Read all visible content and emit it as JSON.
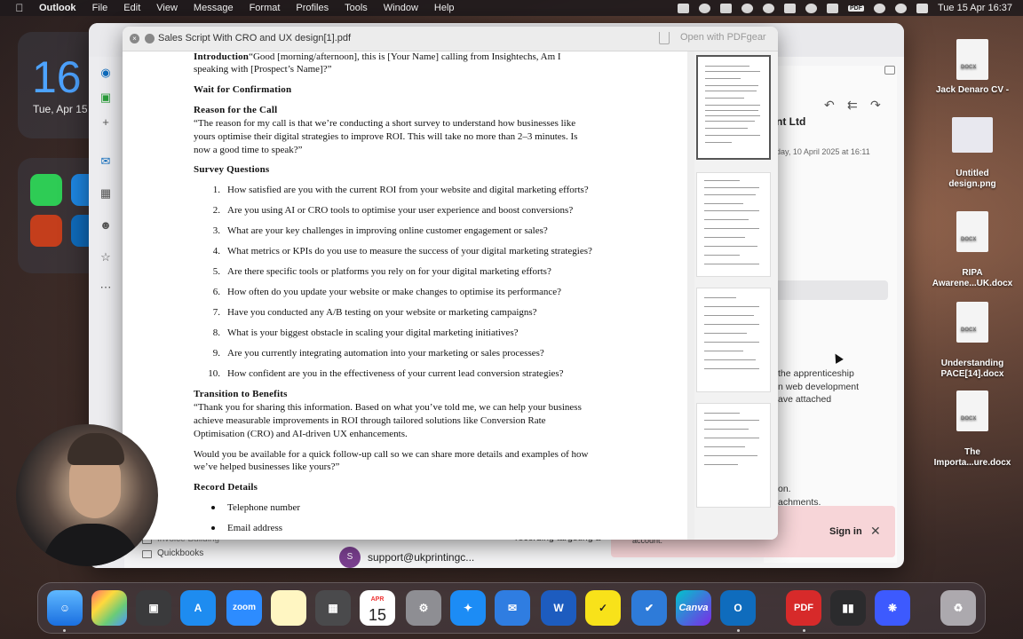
{
  "menubar": {
    "app_name": "Outlook",
    "menus": [
      "File",
      "Edit",
      "View",
      "Message",
      "Format",
      "Profiles",
      "Tools",
      "Window",
      "Help"
    ],
    "datetime": "Tue 15 Apr  16:37",
    "pdf_badge": "PDF"
  },
  "widget": {
    "day": "16",
    "date": "Tue, Apr 15"
  },
  "outlook": {
    "company_fragment": "nt Ltd",
    "date_fragment": "day, 10 April 2025 at 16:11",
    "body_fragment": "the apprenticeship\nn web development\nave attached",
    "body_fragment2": "on.\nachments.",
    "folder": "Quickbooks",
    "folder_prev": "Invoice Building",
    "mail_avatar": "S",
    "mail_from": "support@ukprintingc...",
    "preview_fragment": "recording targeting a",
    "signin_msg": "nething\nfor this\naccount.",
    "signin_button": "Sign in"
  },
  "pdf": {
    "title": "Sales Script With CRO and UX design[1].pdf",
    "open_button": "Open with PDFgear",
    "intro_head": "Introduction",
    "intro_line1": "“Good [morning/afternoon], this is [Your Name] calling from Insightechs, Am I",
    "intro_line2": "speaking with [Prospect’s Name]?”",
    "wait_head": "Wait for Confirmation",
    "reason_head": "Reason for the Call",
    "reason_lines": [
      "“The reason for my call is that we’re conducting a short survey to understand how businesses like",
      "yours optimise their digital strategies to improve ROI. This will take no more than 2–3 minutes. Is",
      "now a good time to speak?”"
    ],
    "survey_head": "Survey Questions",
    "questions": [
      "How satisfied are you with the current ROI from your website and digital marketing efforts?",
      "Are you using AI or CRO tools to optimise your user experience and boost conversions?",
      "What are your key challenges in improving online customer engagement or sales?",
      "What metrics or KPIs do you use to measure the success of your digital marketing strategies?",
      "Are there specific tools or platforms you rely on for your digital marketing efforts?",
      "How often do you update your website or make changes to optimise its performance?",
      "Have you conducted any A/B testing on your website or marketing campaigns?",
      "What is your biggest obstacle in scaling your digital marketing initiatives?",
      "Are you currently integrating automation into your marketing or sales processes?",
      "How confident are you in the effectiveness of your current lead conversion strategies?"
    ],
    "question_numbers": [
      "1.",
      "2.",
      "3.",
      "4.",
      "5.",
      "6.",
      "7.",
      "8.",
      "9.",
      "10."
    ],
    "transition_head": "Transition to Benefits",
    "transition_lines": [
      "“Thank you for sharing this information. Based on what you’ve told me, we can help your business",
      "achieve measurable improvements in ROI through tailored solutions like Conversion Rate",
      "Optimisation (CRO) and AI-driven UX enhancements."
    ],
    "followup_lines": [
      "Would you be available for a quick follow-up call so we can share more details and examples of how",
      "we’ve helped businesses like yours?”"
    ],
    "record_head": "Record Details",
    "record_items": [
      "Telephone number",
      "Email address"
    ]
  },
  "desktop_files": [
    {
      "name": "Jack Denaro CV -",
      "tag": "DOCX"
    },
    {
      "name": "Untitled\ndesign.png",
      "tag": ""
    },
    {
      "name": "RIPA\nAwarene...UK.docx",
      "tag": "DOCX"
    },
    {
      "name": "Understanding\nPACE[14].docx",
      "tag": "DOCX"
    },
    {
      "name": "The\nImporta...ure.docx",
      "tag": "DOCX"
    }
  ],
  "dock": {
    "calendar_month": "APR",
    "calendar_day": "15",
    "zoom_label": "zoom",
    "canva_label": "Canva",
    "pdf_label": "PDF"
  },
  "colors": {
    "accent_blue": "#4da3ff",
    "outlook_blue": "#0f6cbd",
    "signin_bg": "#f7d5d8"
  }
}
